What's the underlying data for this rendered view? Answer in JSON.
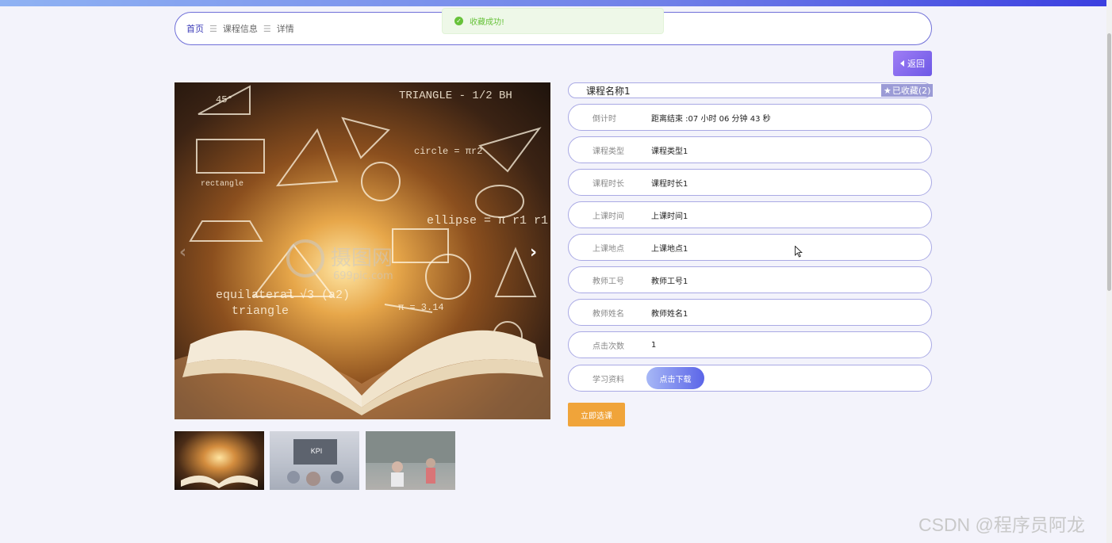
{
  "topbar": {
    "text": ""
  },
  "toast": {
    "message": "收藏成功!"
  },
  "breadcrumb": {
    "home": "首页",
    "sep1": "☰",
    "level2": "课程信息",
    "sep2": "☰",
    "level3": "详情"
  },
  "back_button": {
    "label": "返回"
  },
  "course": {
    "name": "课程名称1",
    "favorite_label": "已收藏(2)",
    "fields": [
      {
        "label": "倒计时",
        "value": "距离结束 :07 小时 06 分钟 43 秒"
      },
      {
        "label": "课程类型",
        "value": "课程类型1"
      },
      {
        "label": "课程时长",
        "value": "课程时长1"
      },
      {
        "label": "上课时间",
        "value": "上课时间1"
      },
      {
        "label": "上课地点",
        "value": "上课地点1"
      },
      {
        "label": "教师工号",
        "value": "教师工号1"
      },
      {
        "label": "教师姓名",
        "value": "教师姓名1"
      },
      {
        "label": "点击次数",
        "value": "1"
      },
      {
        "label": "学习资料",
        "value": "点击下载"
      }
    ],
    "enroll_label": "立即选课"
  },
  "image": {
    "labels": [
      "TRIANGLE - 1/2 BH",
      "45°",
      "circle = πr2",
      "rectangle",
      "ellipse = π r1 r1",
      "equilateral",
      "triangle",
      "= √3 (a2)",
      "π = 3.14",
      "摄图网",
      "699pic.com"
    ]
  },
  "watermark": "CSDN @程序员阿龙",
  "colors": {
    "accent": "#6f6fd8",
    "toast_green": "#67c23a",
    "enroll_orange": "#f0a43a"
  }
}
